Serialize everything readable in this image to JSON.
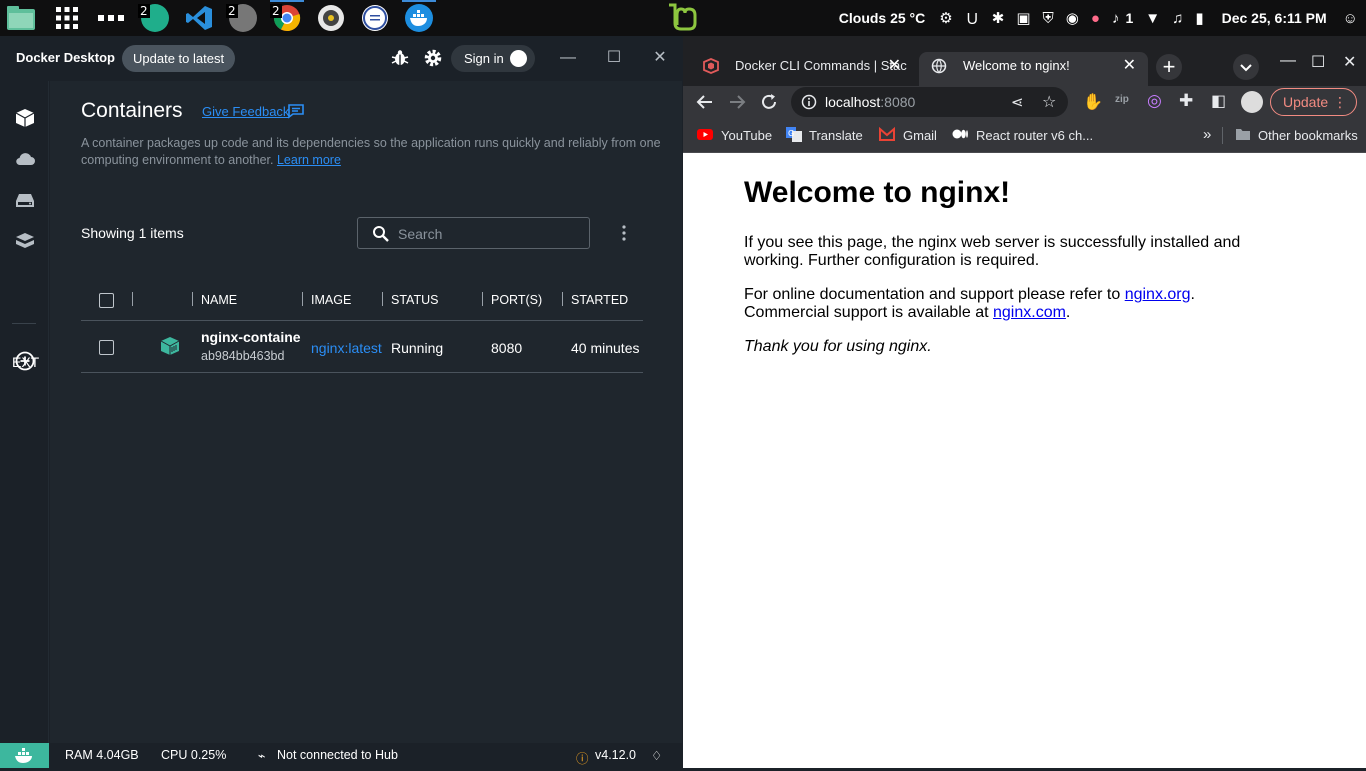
{
  "taskbar": {
    "badges": [
      "2",
      "2",
      "2"
    ],
    "weather": "Clouds 25 °C",
    "notification_count": "1",
    "clock": "Dec 25, 6:11 PM"
  },
  "docker": {
    "app_title": "Docker Desktop",
    "update_label": "Update to latest",
    "signin_label": "Sign in",
    "sidebar": {
      "ext_label": "EXT"
    },
    "page_title": "Containers",
    "feedback_link": "Give Feedback",
    "description": "A container packages up code and its dependencies so the application runs quickly and reliably from one computing environment to another.",
    "learn_more": "Learn more",
    "showing": "Showing 1 items",
    "search": {
      "placeholder": "Search"
    },
    "columns": [
      "NAME",
      "IMAGE",
      "STATUS",
      "PORT(S)",
      "STARTED"
    ],
    "rows": [
      {
        "name": "nginx-container",
        "id": "ab984bb463bd",
        "image": "nginx:latest",
        "status": "Running",
        "port": "8080",
        "started": "40 minutes"
      }
    ],
    "footer": {
      "ram": "RAM 4.04GB",
      "cpu": "CPU 0.25%",
      "hub": "Not connected to Hub",
      "version": "v4.12.0"
    },
    "colors": {
      "accent": "#2b8ef5",
      "whale": "#3db79e"
    }
  },
  "chrome": {
    "tabs": [
      {
        "label": "Docker CLI Commands | Stac",
        "active": false
      },
      {
        "label": "Welcome to nginx!",
        "active": true
      }
    ],
    "url_host": "localhost",
    "url_port": ":8080",
    "update_label": "Update",
    "bookmarks": [
      "YouTube",
      "Translate",
      "Gmail",
      "React router v6 ch...",
      "Other bookmarks"
    ],
    "page": {
      "heading": "Welcome to nginx!",
      "p1": "If you see this page, the nginx web server is successfully installed and working. Further configuration is required.",
      "p2_prefix": "For online documentation and support please refer to ",
      "link1": "nginx.org",
      "p2_mid": ". Commercial support is available at ",
      "link2": "nginx.com",
      "p2_suffix": ".",
      "p3": "Thank you for using nginx."
    }
  }
}
